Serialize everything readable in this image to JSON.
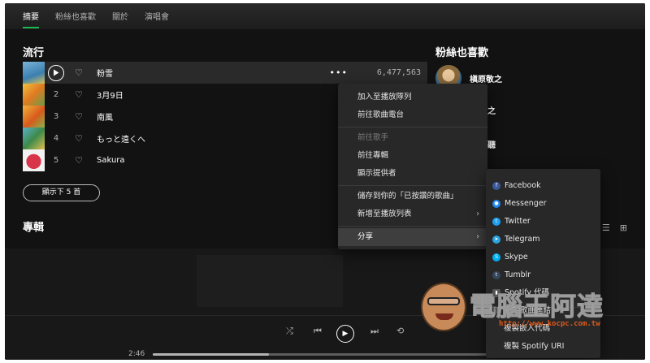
{
  "tabs": [
    "摘要",
    "粉絲也喜歡",
    "關於",
    "演唱會"
  ],
  "popular_title": "流行",
  "tracks": [
    {
      "num": "",
      "title": "粉雪",
      "plays": "6,477,563"
    },
    {
      "num": "2",
      "title": "3月9日",
      "plays": ""
    },
    {
      "num": "3",
      "title": "南風",
      "plays": ""
    },
    {
      "num": "4",
      "title": "もっと遠くへ",
      "plays": ""
    },
    {
      "num": "5",
      "title": "Sakura",
      "plays": ""
    }
  ],
  "show_more": "顯示下 5 首",
  "albums_title": "專輯",
  "fans_title": "粉絲也喜歡",
  "fans": [
    {
      "name": "槇原敬之"
    },
    {
      "name": "之"
    },
    {
      "name": "聽"
    }
  ],
  "context_menu": {
    "items": [
      "加入至播放隊列",
      "前往歌曲電台",
      "前往歌手",
      "前往專輯",
      "顯示提供者",
      "儲存到你的「已按讚的歌曲」",
      "新增至播放列表",
      "分享"
    ]
  },
  "share_menu": {
    "items": [
      "Facebook",
      "Messenger",
      "Twitter",
      "Telegram",
      "Skype",
      "Tumblr",
      "Spotify 代碼",
      "複製歌曲連結",
      "複製嵌入代碼",
      "複製 Spotify URI"
    ],
    "icons": [
      "facebook-icon",
      "messenger-icon",
      "twitter-icon",
      "telegram-icon",
      "skype-icon",
      "tumblr-icon",
      "spotify-code-icon",
      "link-icon",
      "",
      ""
    ]
  },
  "watermark": {
    "text": "電腦王阿達",
    "url": "http://www.kocpc.com.tw"
  },
  "player": {
    "elapsed": "2:46",
    "progress": 0.34
  },
  "colors": {
    "accent": "#1db954",
    "background": "#121212",
    "menu": "#282828",
    "facebook": "#3b5998",
    "twitter": "#1da1f2",
    "telegram": "#2aa3df",
    "skype": "#00aff0",
    "tumblr": "#36465d",
    "messenger": "#1e88f0"
  }
}
